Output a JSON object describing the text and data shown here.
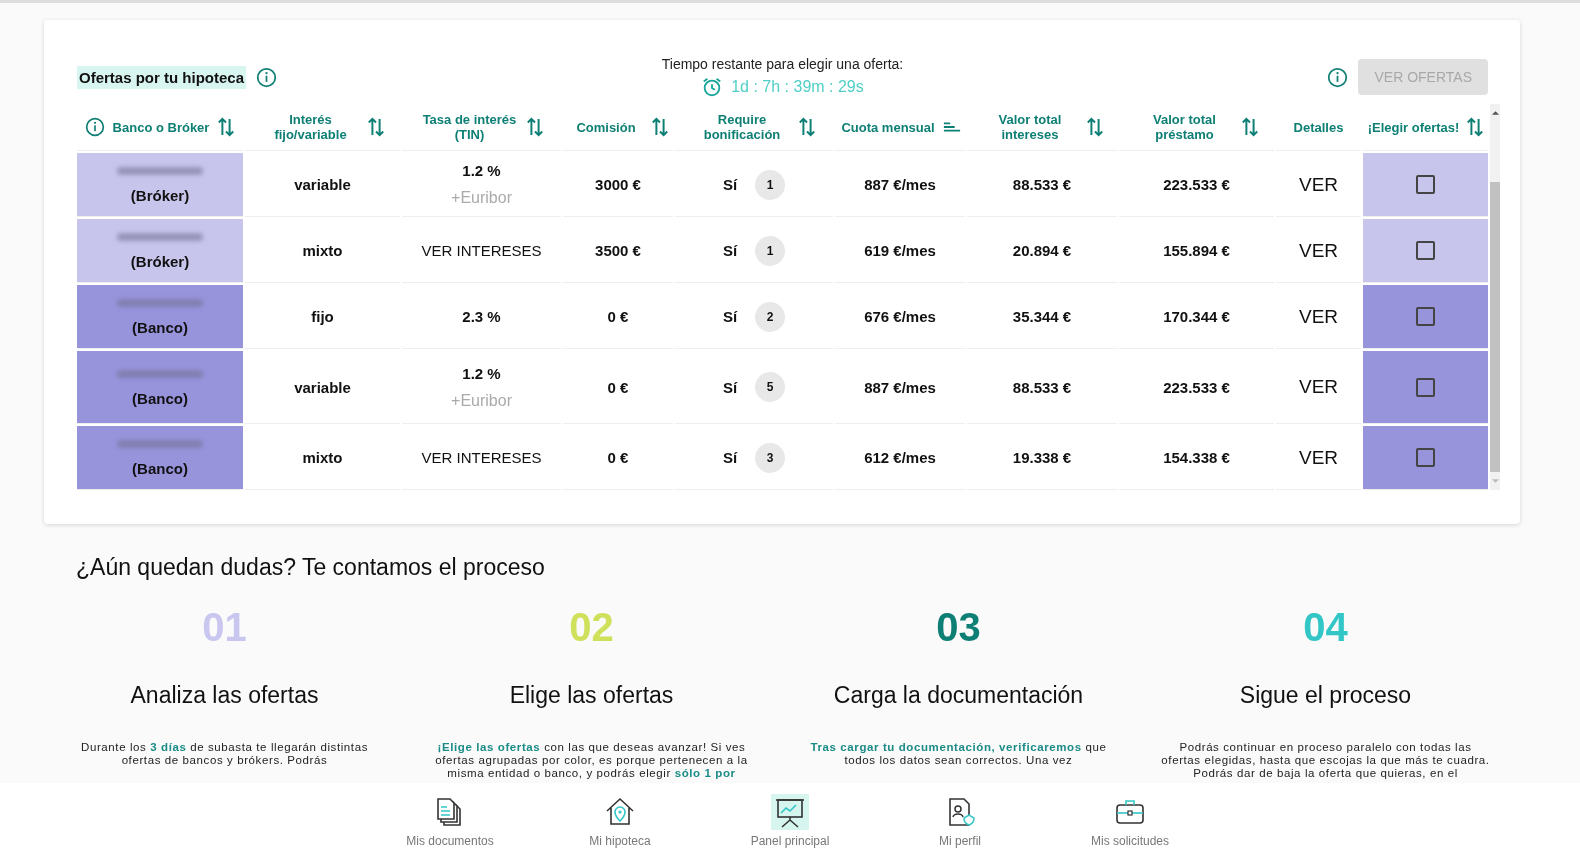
{
  "offers": {
    "title": "Ofertas por tu hipoteca",
    "timer_label": "Tiempo restante para elegir una oferta:",
    "timer": "1d : 7h : 39m : 29s",
    "action": {
      "label": "VER OFERTAS",
      "disabled": true
    },
    "columns": [
      {
        "label": "Banco o Bróker",
        "kind": "sortable",
        "info": true
      },
      {
        "label": "Interés fijo/variable",
        "kind": "sortable"
      },
      {
        "label": "Tasa de interés (TIN)",
        "kind": "sortable"
      },
      {
        "label": "Comisión",
        "kind": "sortable"
      },
      {
        "label": "Require bonificación",
        "kind": "sortable"
      },
      {
        "label": "Cuota mensual",
        "kind": "sorted"
      },
      {
        "label": "Valor total intereses",
        "kind": "sortable"
      },
      {
        "label": "Valor total préstamo",
        "kind": "sortable"
      },
      {
        "label": "Detalles",
        "kind": "plain"
      },
      {
        "label": "¡Elegir ofertas!",
        "kind": "sortable"
      }
    ],
    "rows": [
      {
        "entity": "(Bróker)",
        "color": "#c8c5ec",
        "type": "variable",
        "rate": {
          "kind": "value",
          "text": "1.2 %",
          "note": "+Euribor"
        },
        "commission": "3000 €",
        "bonus": "Sí",
        "bonus_count": "1",
        "fee": "887 €/mes",
        "interest": "88.533 €",
        "total": "223.533 €",
        "details": "VER",
        "checked": false
      },
      {
        "entity": "(Bróker)",
        "color": "#c8c5ec",
        "type": "mixto",
        "rate": {
          "kind": "link",
          "text": "VER INTERESES"
        },
        "commission": "3500 €",
        "bonus": "Sí",
        "bonus_count": "1",
        "fee": "619 €/mes",
        "interest": "20.894 €",
        "total": "155.894 €",
        "details": "VER",
        "checked": false
      },
      {
        "entity": "(Banco)",
        "color": "#9794dc",
        "type": "fijo",
        "rate": {
          "kind": "value",
          "text": "2.3 %"
        },
        "commission": "0 €",
        "bonus": "Sí",
        "bonus_count": "2",
        "fee": "676 €/mes",
        "interest": "35.344 €",
        "total": "170.344 €",
        "details": "VER",
        "checked": false
      },
      {
        "entity": "(Banco)",
        "color": "#9794dc",
        "type": "variable",
        "rate": {
          "kind": "value",
          "text": "1.2 %",
          "note": "+Euribor"
        },
        "commission": "0 €",
        "bonus": "Sí",
        "bonus_count": "5",
        "fee": "887 €/mes",
        "interest": "88.533 €",
        "total": "223.533 €",
        "details": "VER",
        "checked": false
      },
      {
        "entity": "(Banco)",
        "color": "#9794dc",
        "type": "mixto",
        "rate": {
          "kind": "link",
          "text": "VER INTERESES"
        },
        "commission": "0 €",
        "bonus": "Sí",
        "bonus_count": "3",
        "fee": "612 €/mes",
        "interest": "19.338 €",
        "total": "154.338 €",
        "details": "VER",
        "checked": false
      }
    ]
  },
  "process": {
    "title": "¿Aún quedan dudas? Te contamos el proceso",
    "steps": [
      {
        "number": "01",
        "color": "#c9c6ef",
        "title": "Analiza las ofertas",
        "text": "Durante los **3 días** de subasta te llegarán distintas ofertas de bancos y brókers. Podrás"
      },
      {
        "number": "02",
        "color": "#cfe05a",
        "title": "Elige las ofertas",
        "text": "**¡Elige las ofertas** con las que deseas avanzar! Si ves ofertas agrupadas por color, es porque pertenecen a la misma entidad o banco, y podrás elegir **sólo 1 por**"
      },
      {
        "number": "03",
        "color": "#0e7f74",
        "title": "Carga la documentación",
        "text": "**Tras cargar tu documentación, verificaremos** que todos los datos sean correctos. Una vez"
      },
      {
        "number": "04",
        "color": "#33c6c6",
        "title": "Sigue el proceso",
        "text": "Podrás continuar en proceso paralelo con todas las ofertas elegidas, hasta que escojas la que más te cuadra. Podrás dar de baja la oferta que quieras, en el"
      }
    ]
  },
  "nav": [
    {
      "label": "Mis documentos",
      "selected": false
    },
    {
      "label": "Mi hipoteca",
      "selected": false
    },
    {
      "label": "Panel principal",
      "selected": true
    },
    {
      "label": "Mi perfil",
      "selected": false
    },
    {
      "label": "Mis solicitudes",
      "selected": false
    }
  ]
}
